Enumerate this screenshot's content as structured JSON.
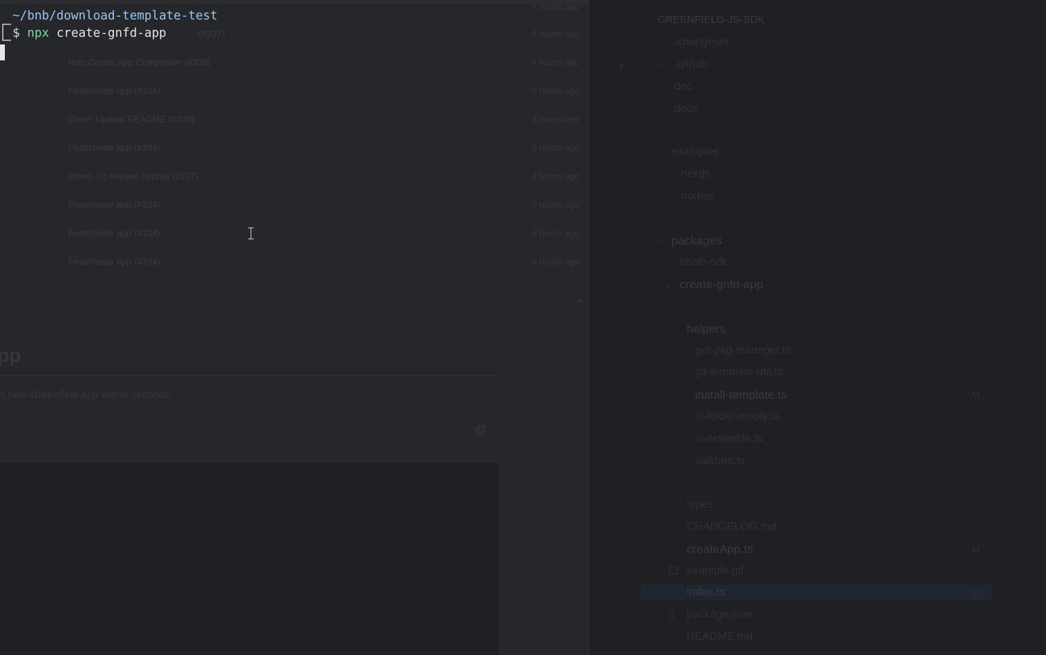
{
  "terminal": {
    "cwd": "~/bnb/download-template-test",
    "prompt_symbol": "$",
    "command_bin": "npx",
    "command_args": "create-gnfd-app"
  },
  "background_page": {
    "commits": [
      {
        "message": "(#337)",
        "time": "4 hours ago"
      },
      {
        "message": "feat: Create App Companion (#336)",
        "time": "4 hours ago"
      },
      {
        "message": "Feat/create app (#334)",
        "time": "5 hours ago"
      },
      {
        "message": "chore: Update README (#338)",
        "time": "3 hours ago"
      },
      {
        "message": "Feat/create app (#334)",
        "time": "6 hours ago"
      },
      {
        "message": "chore: (#) release (alpha) (#337)",
        "time": "4 hours ago"
      },
      {
        "message": "Feat/create app (#334)",
        "time": "6 hours ago"
      },
      {
        "message": "Feat/create app (#334)",
        "time": "6 hours ago"
      },
      {
        "message": "Feat/create app (#334)",
        "time": "6 hours ago"
      }
    ],
    "top_time": "4 hours ago",
    "heading": "pp",
    "description": "s new Greenfield app within seconds."
  },
  "explorer": {
    "root": "GREENFIELD-JS-SDK",
    "badge_number": "4",
    "items": [
      {
        "label": ".changeset"
      },
      {
        "label": ".github"
      },
      {
        "label": "doc"
      },
      {
        "label": "docs"
      },
      {
        "label": "examples"
      },
      {
        "label": "nextjs"
      },
      {
        "label": "nodejs"
      },
      {
        "label": "packages"
      },
      {
        "label": "chain-sdk"
      },
      {
        "label": "create-gnfd-app"
      },
      {
        "label": "helpers"
      },
      {
        "label": "get-pkg-manager.ts"
      },
      {
        "label": "git-template-util.ts"
      },
      {
        "label": "install-template.ts"
      },
      {
        "label": "is-folder-empty.ts"
      },
      {
        "label": "is-writeable.ts"
      },
      {
        "label": "validate.ts"
      },
      {
        "label": "types"
      },
      {
        "label": "CHANGELOG.md"
      },
      {
        "label": "createApp.ts"
      },
      {
        "label": "example.gif"
      },
      {
        "label": "index.ts"
      },
      {
        "label": "package.json"
      },
      {
        "label": "README.md"
      }
    ],
    "modified_badge": "M"
  },
  "colors": {
    "terminal_path": "#9cc6f0",
    "terminal_npx": "#7fd6a4",
    "terminal_text": "#e6e6e6"
  }
}
